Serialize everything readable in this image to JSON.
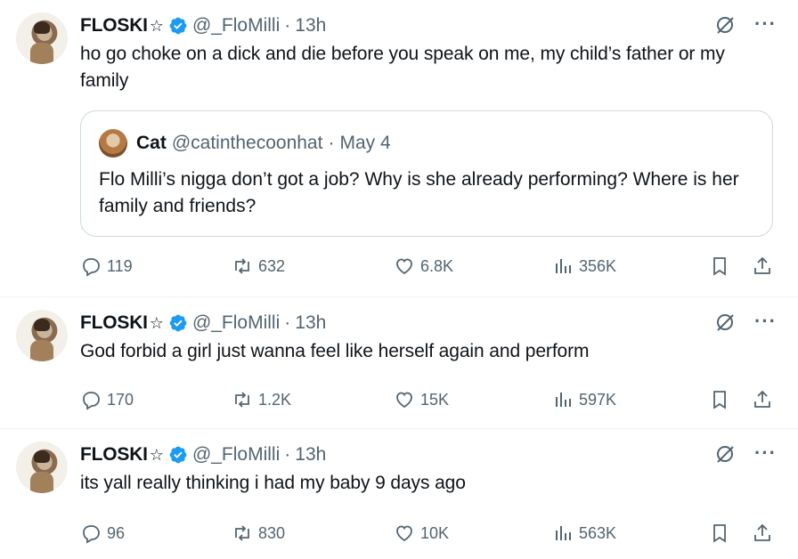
{
  "tweets": [
    {
      "display_name": "FLOSKI",
      "name_suffix": "☆",
      "handle": "@_FloMilli",
      "separator": "·",
      "time": "13h",
      "text": "ho go choke on a dick and die before you speak on me, my child’s father or my family",
      "quote": {
        "display_name": "Cat",
        "handle": "@catinthecoonhat",
        "separator": "·",
        "date": "May 4",
        "text": "Flo Milli’s nigga don’t got a job? Why is she already performing? Where is her family and friends?"
      },
      "replies": "119",
      "reposts": "632",
      "likes": "6.8K",
      "views": "356K"
    },
    {
      "display_name": "FLOSKI",
      "name_suffix": "☆",
      "handle": "@_FloMilli",
      "separator": "·",
      "time": "13h",
      "text": "God forbid a girl just wanna feel like herself again and perform",
      "replies": "170",
      "reposts": "1.2K",
      "likes": "15K",
      "views": "597K"
    },
    {
      "display_name": "FLOSKI",
      "name_suffix": "☆",
      "handle": "@_FloMilli",
      "separator": "·",
      "time": "13h",
      "text": "its yall really thinking i had my baby 9 days ago",
      "replies": "96",
      "reposts": "830",
      "likes": "10K",
      "views": "563K"
    }
  ],
  "more_label": "···",
  "icons": {
    "verified": "verified-badge-icon",
    "grok": "grok-icon",
    "reply": "reply-icon",
    "repost": "repost-icon",
    "like": "heart-icon",
    "views": "views-icon",
    "bookmark": "bookmark-icon",
    "share": "share-icon"
  },
  "colors": {
    "text": "#0f1419",
    "secondary": "#536471",
    "verified": "#1d9bf0",
    "border": "#cfd9de"
  }
}
